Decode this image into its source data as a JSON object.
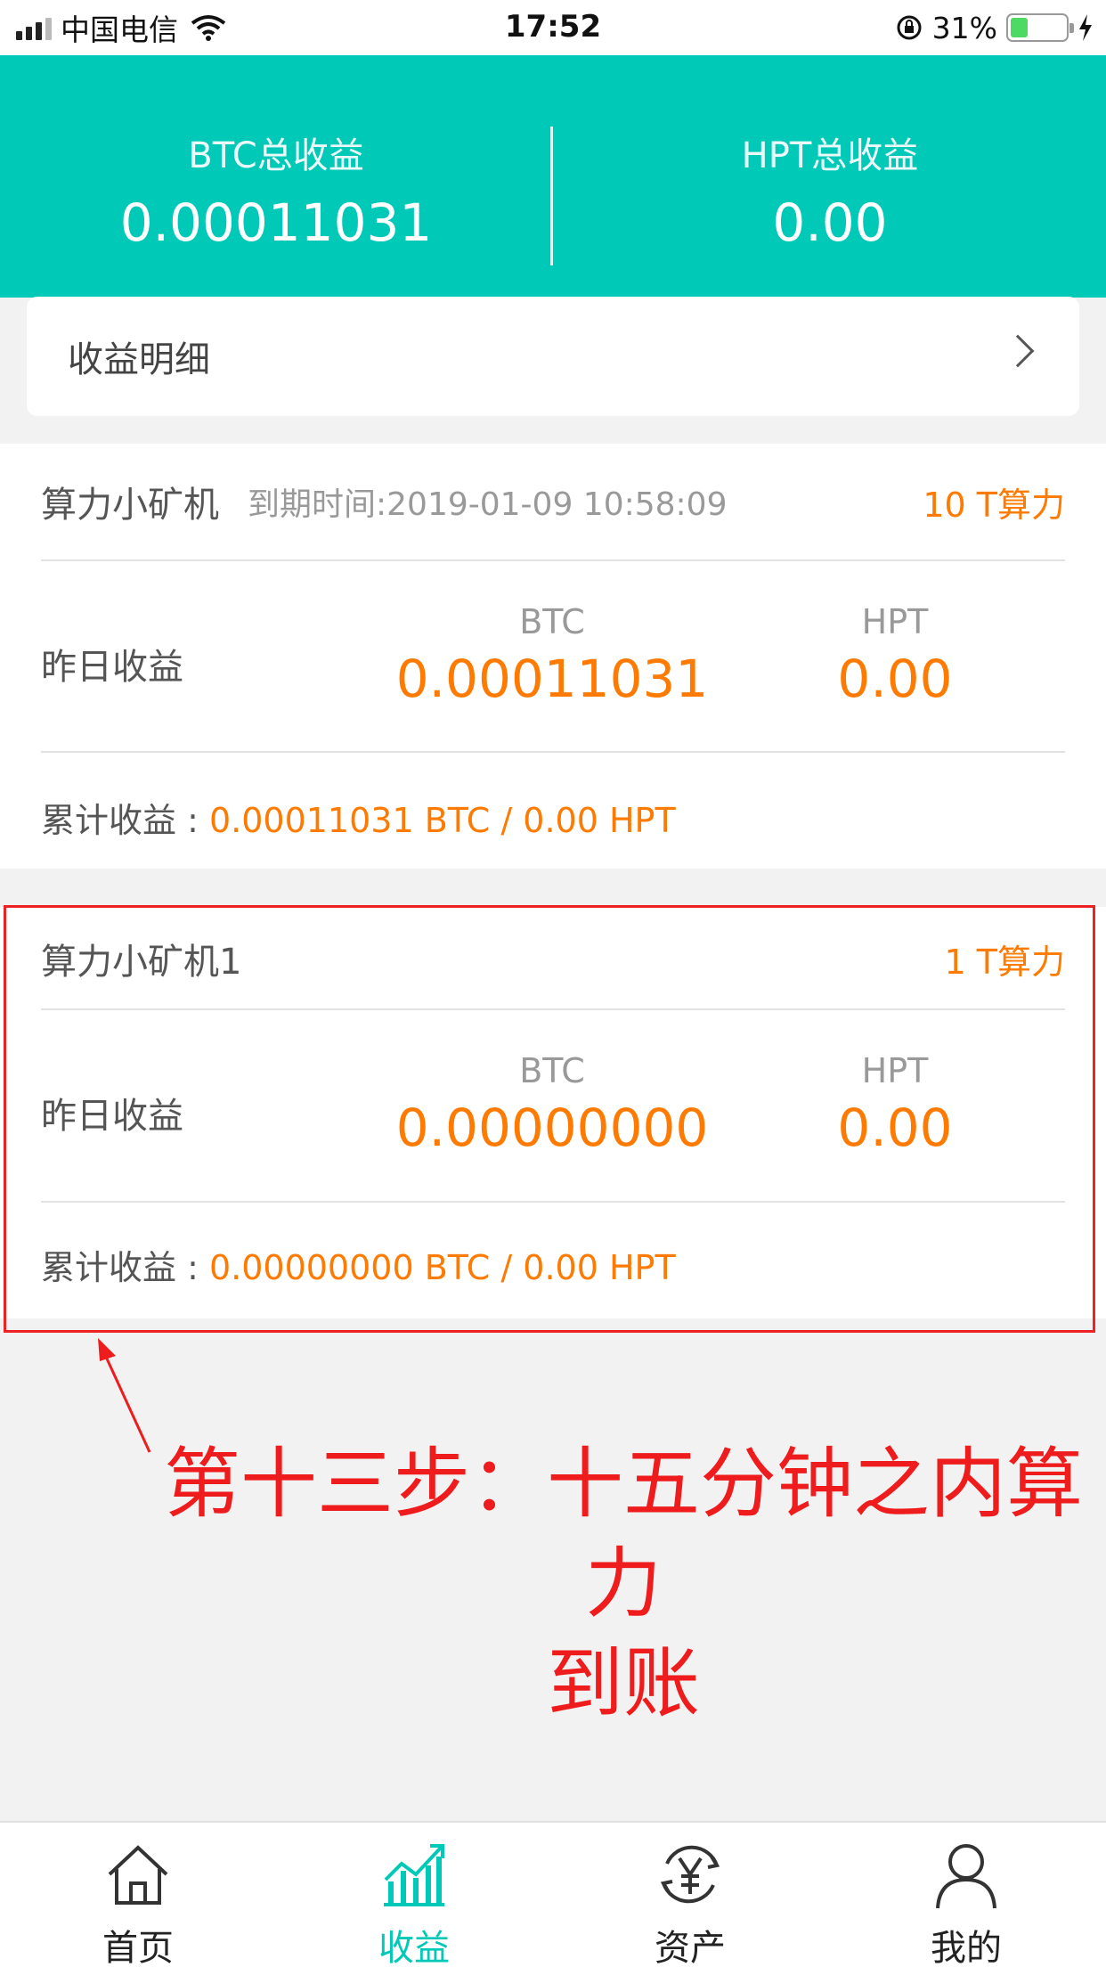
{
  "status_bar": {
    "carrier": "中国电信",
    "time": "17:52",
    "battery_pct": "31%",
    "battery_level": 0.31
  },
  "header": {
    "btc_label": "BTC总收益",
    "btc_value": "0.00011031",
    "hpt_label": "HPT总收益",
    "hpt_value": "0.00"
  },
  "detail_bar": {
    "label": "收益明细"
  },
  "miners": [
    {
      "name": "算力小矿机",
      "expiry": "到期时间:2019-01-09 10:58:09",
      "hashrate": "10 T算力",
      "yesterday_label": "昨日收益",
      "btc_label": "BTC",
      "btc_value": "0.00011031",
      "hpt_label": "HPT",
      "hpt_value": "0.00",
      "total_label": "累计收益 : ",
      "total_value": "0.00011031 BTC / 0.00 HPT"
    },
    {
      "name": "算力小矿机1",
      "expiry": "",
      "hashrate": "1 T算力",
      "yesterday_label": "昨日收益",
      "btc_label": "BTC",
      "btc_value": "0.00000000",
      "hpt_label": "HPT",
      "hpt_value": "0.00",
      "total_label": "累计收益 : ",
      "total_value": "0.00000000 BTC / 0.00 HPT"
    }
  ],
  "annotation": {
    "line1": "第十三步：十五分钟之内算力",
    "line2": "到账",
    "color": "#ee1c1c"
  },
  "tabbar": {
    "tabs": [
      {
        "label": "首页",
        "icon": "home-icon"
      },
      {
        "label": "收益",
        "icon": "chart-icon",
        "active": true
      },
      {
        "label": "资产",
        "icon": "yuan-icon"
      },
      {
        "label": "我的",
        "icon": "user-icon"
      }
    ]
  },
  "colors": {
    "accent": "#00c9b8",
    "highlight": "#ff7a00"
  }
}
